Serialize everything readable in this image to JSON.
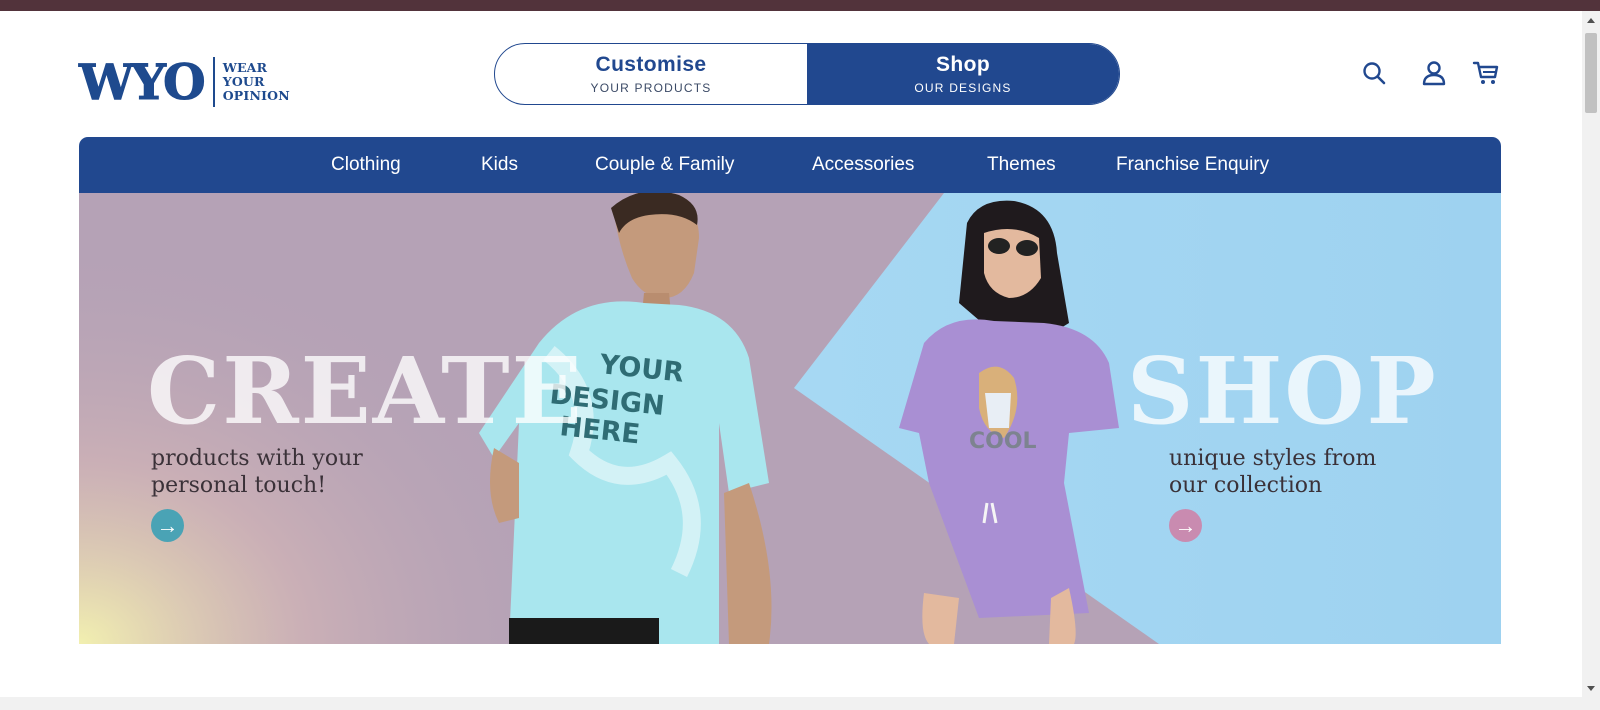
{
  "brand": {
    "logo_mark": "WYO",
    "tagline": [
      "WEAR",
      "YOUR",
      "OPINION"
    ],
    "color": "#1e4a8e"
  },
  "toggle": {
    "customise": {
      "label": "Customise",
      "sub": "YOUR PRODUCTS"
    },
    "shop": {
      "label": "Shop",
      "sub": "OUR DESIGNS"
    },
    "active": "shop"
  },
  "header_icons": [
    "search-icon",
    "user-icon",
    "cart-icon"
  ],
  "nav": {
    "items": [
      {
        "label": "Clothing"
      },
      {
        "label": "Kids"
      },
      {
        "label": "Couple & Family"
      },
      {
        "label": "Accessories"
      },
      {
        "label": "Themes"
      },
      {
        "label": "Franchise Enquiry"
      }
    ]
  },
  "hero": {
    "left": {
      "word": "CREATE",
      "line1": "products with your",
      "line2": "personal touch!",
      "arrow_color": "#4aa3b5"
    },
    "right": {
      "word": "SHOP",
      "line1": "unique styles from",
      "line2": "our collection",
      "arrow_color": "#c98bb0"
    },
    "tshirt_print": [
      "YOUR",
      "DESIGN",
      "HERE"
    ],
    "shirt_graphic_text": "COOL"
  },
  "colors": {
    "primary": "#21488f",
    "topbar": "#52333b",
    "hero_left_bg": "#b5a2b6",
    "hero_right_bg": "#9fd4f2"
  }
}
